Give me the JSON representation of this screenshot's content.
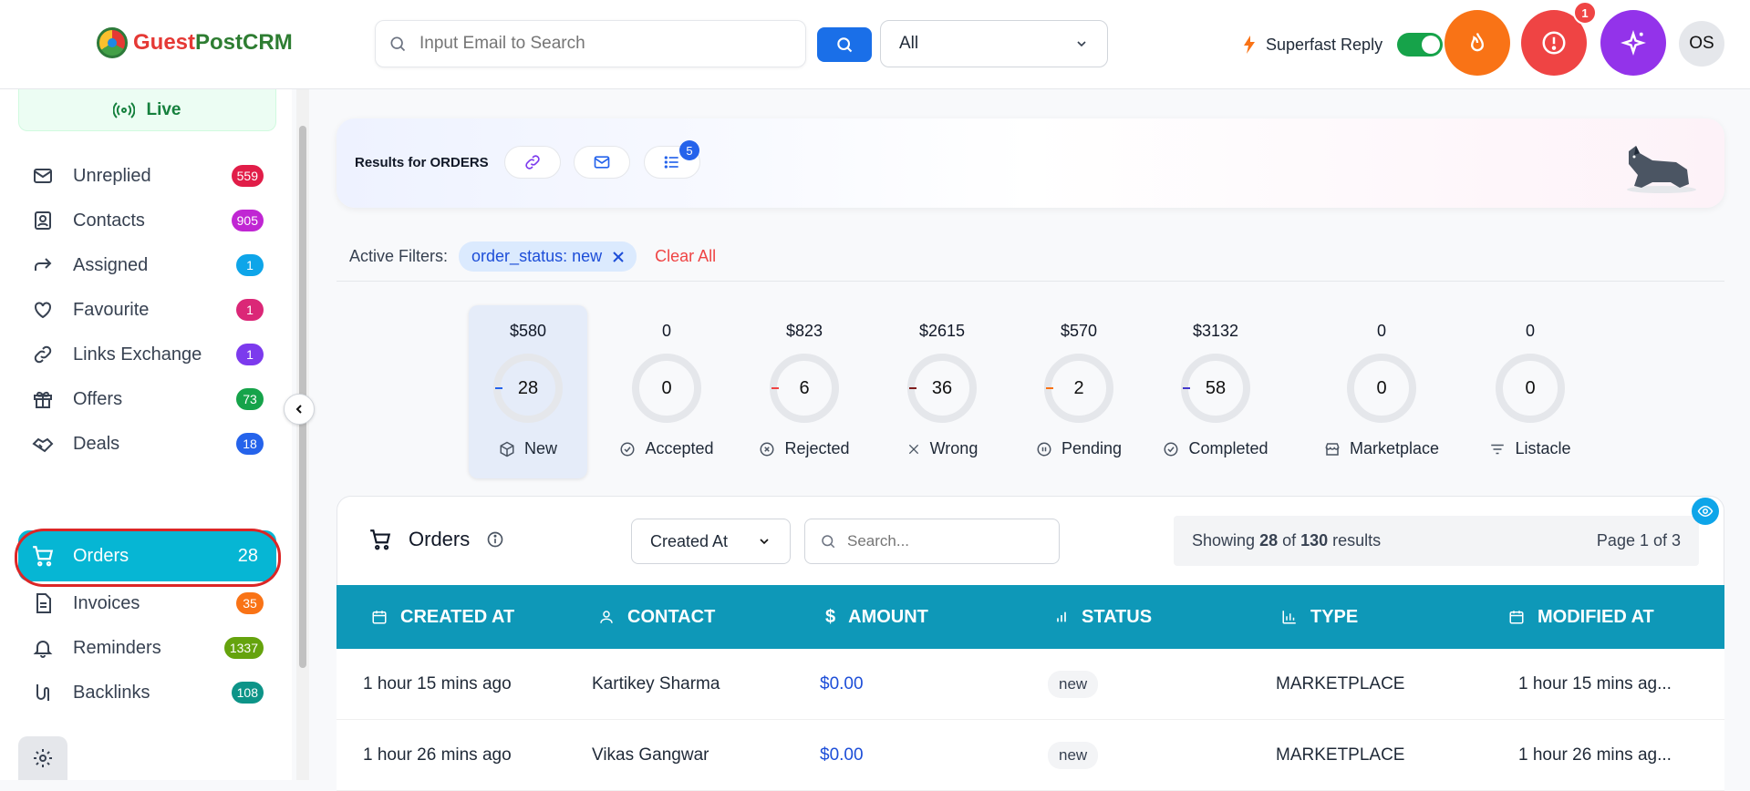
{
  "header": {
    "logo_part1": "Guest",
    "logo_part2": "PostCRM",
    "search_placeholder": "Input Email to Search",
    "filter_value": "All",
    "superfast_label": "Superfast Reply",
    "alert_count": "1",
    "avatar_initials": "OS"
  },
  "sidebar": {
    "live_label": "Live",
    "items": [
      {
        "label": "Unreplied",
        "count": "559",
        "color": "#e11d48"
      },
      {
        "label": "Contacts",
        "count": "905",
        "color": "#c026d3"
      },
      {
        "label": "Assigned",
        "count": "1",
        "color": "#0ea5e9"
      },
      {
        "label": "Favourite",
        "count": "1",
        "color": "#db2777"
      },
      {
        "label": "Links Exchange",
        "count": "1",
        "color": "#7c3aed"
      },
      {
        "label": "Offers",
        "count": "73",
        "color": "#16a34a"
      },
      {
        "label": "Deals",
        "count": "18",
        "color": "#2563eb"
      },
      {
        "label": "Orders",
        "count": "28",
        "color": "#06b6d4"
      },
      {
        "label": "Invoices",
        "count": "35",
        "color": "#f97316"
      },
      {
        "label": "Reminders",
        "count": "1337",
        "color": "#65a30d"
      },
      {
        "label": "Backlinks",
        "count": "108",
        "color": "#0d9488"
      }
    ]
  },
  "results": {
    "title": "Results for ORDERS",
    "list_count": "5"
  },
  "filters": {
    "label": "Active Filters:",
    "chip": "order_status: new",
    "clear_all": "Clear All"
  },
  "stats": [
    {
      "amount": "$580",
      "count": "28",
      "label": "New",
      "tick": "#2563eb"
    },
    {
      "amount": "0",
      "count": "0",
      "label": "Accepted",
      "tick": ""
    },
    {
      "amount": "$823",
      "count": "6",
      "label": "Rejected",
      "tick": "#ef4444"
    },
    {
      "amount": "$2615",
      "count": "36",
      "label": "Wrong",
      "tick": "#7f1d1d"
    },
    {
      "amount": "$570",
      "count": "2",
      "label": "Pending",
      "tick": "#f97316"
    },
    {
      "amount": "$3132",
      "count": "58",
      "label": "Completed",
      "tick": "#4338ca"
    },
    {
      "amount": "0",
      "count": "0",
      "label": "Marketplace",
      "tick": ""
    },
    {
      "amount": "0",
      "count": "0",
      "label": "Listacle",
      "tick": ""
    }
  ],
  "orders": {
    "title": "Orders",
    "sort_value": "Created At",
    "search_placeholder": "Search...",
    "showing_prefix": "Showing ",
    "showing_count": "28",
    "showing_mid": " of ",
    "showing_total": "130",
    "showing_suffix": " results",
    "page_label": "Page 1 of 3",
    "columns": [
      "CREATED AT",
      "CONTACT",
      "AMOUNT",
      "STATUS",
      "TYPE",
      "MODIFIED AT"
    ],
    "rows": [
      {
        "created": "1 hour 15 mins ago",
        "contact": "Kartikey Sharma",
        "amount": "$0.00",
        "status": "new",
        "type": "MARKETPLACE",
        "modified": "1 hour 15 mins ag..."
      },
      {
        "created": "1 hour 26 mins ago",
        "contact": "Vikas Gangwar",
        "amount": "$0.00",
        "status": "new",
        "type": "MARKETPLACE",
        "modified": "1 hour 26 mins ag..."
      }
    ]
  }
}
